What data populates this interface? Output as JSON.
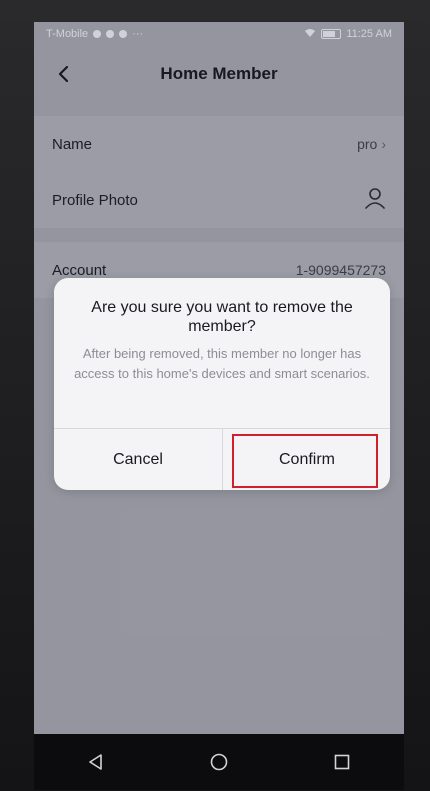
{
  "status_bar": {
    "carrier": "T-Mobile",
    "extra": "···",
    "time": "11:25 AM"
  },
  "header": {
    "title": "Home Member"
  },
  "profile_section": {
    "rows": [
      {
        "label": "Name",
        "value": "pro"
      },
      {
        "label": "Profile Photo",
        "icon": "user-avatar-icon"
      }
    ]
  },
  "account_section": {
    "rows": [
      {
        "label": "Account",
        "value": "1-9099457273"
      }
    ]
  },
  "dialog": {
    "title": "Are you sure you want to remove the member?",
    "message": "After being removed, this member no longer has access to this home's devices and smart scenarios.",
    "cancel_label": "Cancel",
    "confirm_label": "Confirm"
  },
  "colors": {
    "highlight": "#d21f2a",
    "dim_background": "#9f9fa8"
  },
  "nav_bar": {
    "icons": [
      "back-triangle-icon",
      "home-circle-icon",
      "recents-square-icon"
    ]
  }
}
